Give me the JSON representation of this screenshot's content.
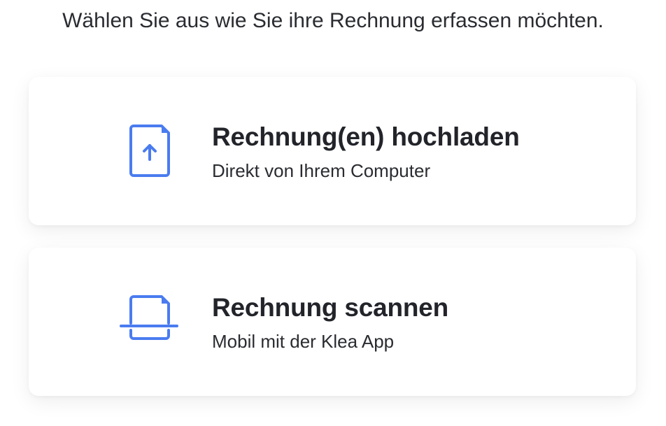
{
  "instruction": "Wählen Sie aus wie Sie ihre Rechnung erfassen möchten.",
  "accent_color": "#4a7cf0",
  "options": [
    {
      "icon": "file-upload-icon",
      "title": "Rechnung(en) hochladen",
      "subtitle": "Direkt von Ihrem Computer"
    },
    {
      "icon": "document-scan-icon",
      "title": "Rechnung scannen",
      "subtitle": "Mobil mit der Klea App"
    }
  ]
}
